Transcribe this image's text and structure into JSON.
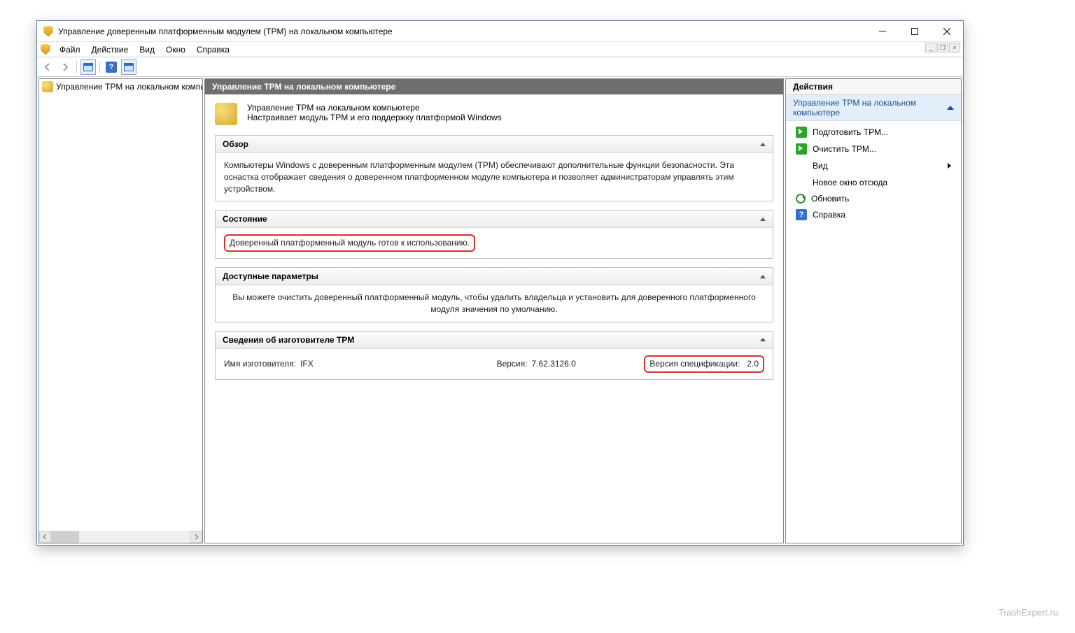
{
  "titlebar": {
    "title": "Управление доверенным платформенным модулем (TPM) на локальном компьютере"
  },
  "menu": {
    "items": [
      "Файл",
      "Действие",
      "Вид",
      "Окно",
      "Справка"
    ]
  },
  "tree": {
    "root": "Управление TPM на локальном компьютере"
  },
  "content": {
    "header": "Управление TPM на локальном компьютере",
    "intro_line1": "Управление TPM на локальном компьютере",
    "intro_line2": "Настраивает модуль TPM и его поддержку платформой Windows",
    "sections": {
      "overview": {
        "title": "Обзор",
        "body": "Компьютеры Windows с доверенным платформенным модулем (TPM) обеспечивают дополнительные функции безопасности. Эта оснастка отображает сведения о доверенном платформенном модуле компьютера и позволяет администраторам управлять этим устройством."
      },
      "status": {
        "title": "Состояние",
        "body": "Доверенный платформенный модуль готов к использованию."
      },
      "params": {
        "title": "Доступные параметры",
        "body": "Вы можете очистить доверенный платформенный модуль, чтобы удалить владельца и установить для доверенного платформенного модуля значения по умолчанию."
      },
      "manufacturer": {
        "title": "Сведения об изготовителе TPM",
        "name_label": "Имя изготовителя:",
        "name_value": "IFX",
        "version_label": "Версия:",
        "version_value": "7.62.3126.0",
        "spec_label": "Версия спецификации:",
        "spec_value": "2.0"
      }
    }
  },
  "actions": {
    "title": "Действия",
    "subtitle": "Управление TPM на локальном компьютере",
    "items": {
      "prepare": "Подготовить TPM...",
      "clear": "Очистить TPM...",
      "view": "Вид",
      "new_window": "Новое окно отсюда",
      "refresh": "Обновить",
      "help": "Справка"
    }
  },
  "watermark": "TrashExpert.ru"
}
